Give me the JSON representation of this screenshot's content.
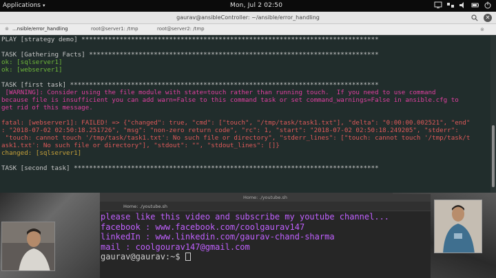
{
  "system_panel": {
    "applications_label": "Applications",
    "clock": "Mon, Jul 2   02:50"
  },
  "terminal": {
    "title": "gaurav@ansibleController: ~/ansible/error_handling",
    "tabs": [
      {
        "label": "...nsible/error_handling"
      },
      {
        "label": "root@server1: /tmp"
      },
      {
        "label": "root@server2: /tmp"
      }
    ],
    "lines": [
      {
        "text": "PLAY [strategy demo] ******************************************************************************",
        "cls": "c-dim"
      },
      {
        "text": "",
        "cls": "c-dim"
      },
      {
        "text": "TASK [Gathering Facts] ****************************************************************************",
        "cls": "c-dim"
      },
      {
        "text": "ok: [sqlserver1]",
        "cls": "c-ok"
      },
      {
        "text": "ok: [webserver1]",
        "cls": "c-ok"
      },
      {
        "text": "",
        "cls": "c-dim"
      },
      {
        "text": "TASK [first task] *********************************************************************************",
        "cls": "c-dim"
      },
      {
        "text": " [WARNING]: Consider using the file module with state=touch rather than running touch.  If you need to use command",
        "cls": "c-warn"
      },
      {
        "text": "because file is insufficient you can add warn=False to this command task or set command_warnings=False in ansible.cfg to",
        "cls": "c-warn"
      },
      {
        "text": "get rid of this message.",
        "cls": "c-warn"
      },
      {
        "text": "",
        "cls": "c-dim"
      },
      {
        "text": "fatal: [webserver1]: FAILED! => {\"changed\": true, \"cmd\": [\"touch\", \"/tmp/task/task1.txt\"], \"delta\": \"0:00:00.002521\", \"end\"",
        "cls": "c-err"
      },
      {
        "text": ": \"2018-07-02 02:50:18.251726\", \"msg\": \"non-zero return code\", \"rc\": 1, \"start\": \"2018-07-02 02:50:18.249205\", \"stderr\":",
        "cls": "c-err"
      },
      {
        "text": " \"touch: cannot touch '/tmp/task/task1.txt': No such file or directory\", \"stderr_lines\": [\"touch: cannot touch '/tmp/task/t",
        "cls": "c-err"
      },
      {
        "text": "ask1.txt': No such file or directory\"], \"stdout\": \"\", \"stdout_lines\": []}",
        "cls": "c-err"
      },
      {
        "text": "changed: [sqlserver1]",
        "cls": "c-chg"
      },
      {
        "text": "",
        "cls": "c-dim"
      },
      {
        "text": "TASK [second task] ********************************************************************************",
        "cls": "c-dim"
      }
    ]
  },
  "youtube_terminal": {
    "title": "Home: ./youtube.sh",
    "tab_label": "Home: ./youtube.sh",
    "lines": [
      "please like this video and subscribe my youtube channel...",
      "facebook : www.facebook.com/coolgaurav147",
      "linkedIn : www.linkedin.com/gaurav-chand-sharma",
      "mail : coolgourav147@gmail.com"
    ],
    "prompt": "gaurav@gaurav:~$ "
  },
  "colors": {
    "ok": "#6fb83a",
    "error": "#e05a5a",
    "warning": "#e040a0",
    "changed": "#c7a23a",
    "promo": "#c060ff"
  },
  "icons": [
    "apps-menu-icon",
    "network-icon",
    "volume-icon",
    "battery-icon",
    "power-icon",
    "search-icon",
    "close-icon"
  ]
}
